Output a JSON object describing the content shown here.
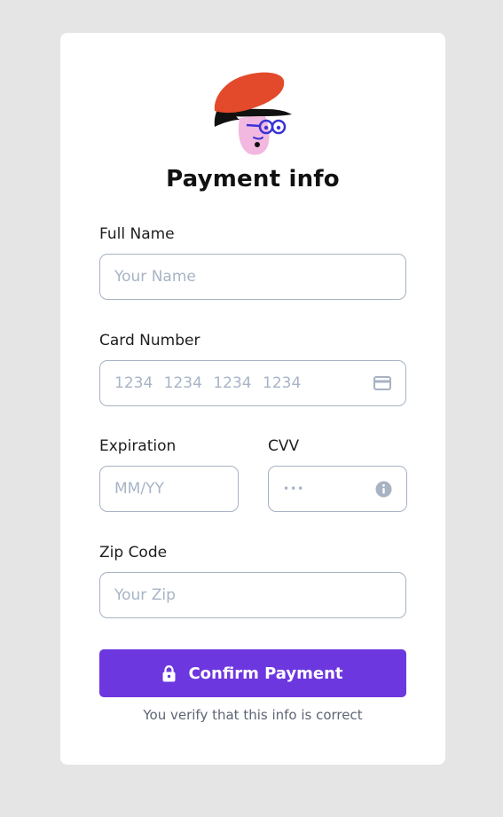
{
  "page": {
    "title": "Payment info",
    "verify_note": "You verify that this info is correct"
  },
  "avatar": {
    "icon": "illustrated-person-avatar-icon"
  },
  "form": {
    "full_name": {
      "label": "Full Name",
      "placeholder": "Your Name",
      "value": ""
    },
    "card_number": {
      "label": "Card Number",
      "placeholder": "1234 1234 1234 1234",
      "value": "",
      "icon": "credit-card-icon"
    },
    "expiration": {
      "label": "Expiration",
      "placeholder": "MM/YY",
      "value": ""
    },
    "cvv": {
      "label": "CVV",
      "placeholder": "•••",
      "value": "",
      "icon": "info-icon"
    },
    "zip": {
      "label": "Zip Code",
      "placeholder": "Your Zip",
      "value": ""
    }
  },
  "confirm_button": {
    "label": "Confirm Payment",
    "icon": "lock-icon"
  },
  "colors": {
    "background": "#e5e5e5",
    "card": "#ffffff",
    "accent": "#6d37e0",
    "input_border": "#a7b2c2",
    "placeholder": "#a7b4c6",
    "hat": "#e34a2b",
    "face": "#f2b8e0",
    "glasses": "#3a33d6"
  }
}
